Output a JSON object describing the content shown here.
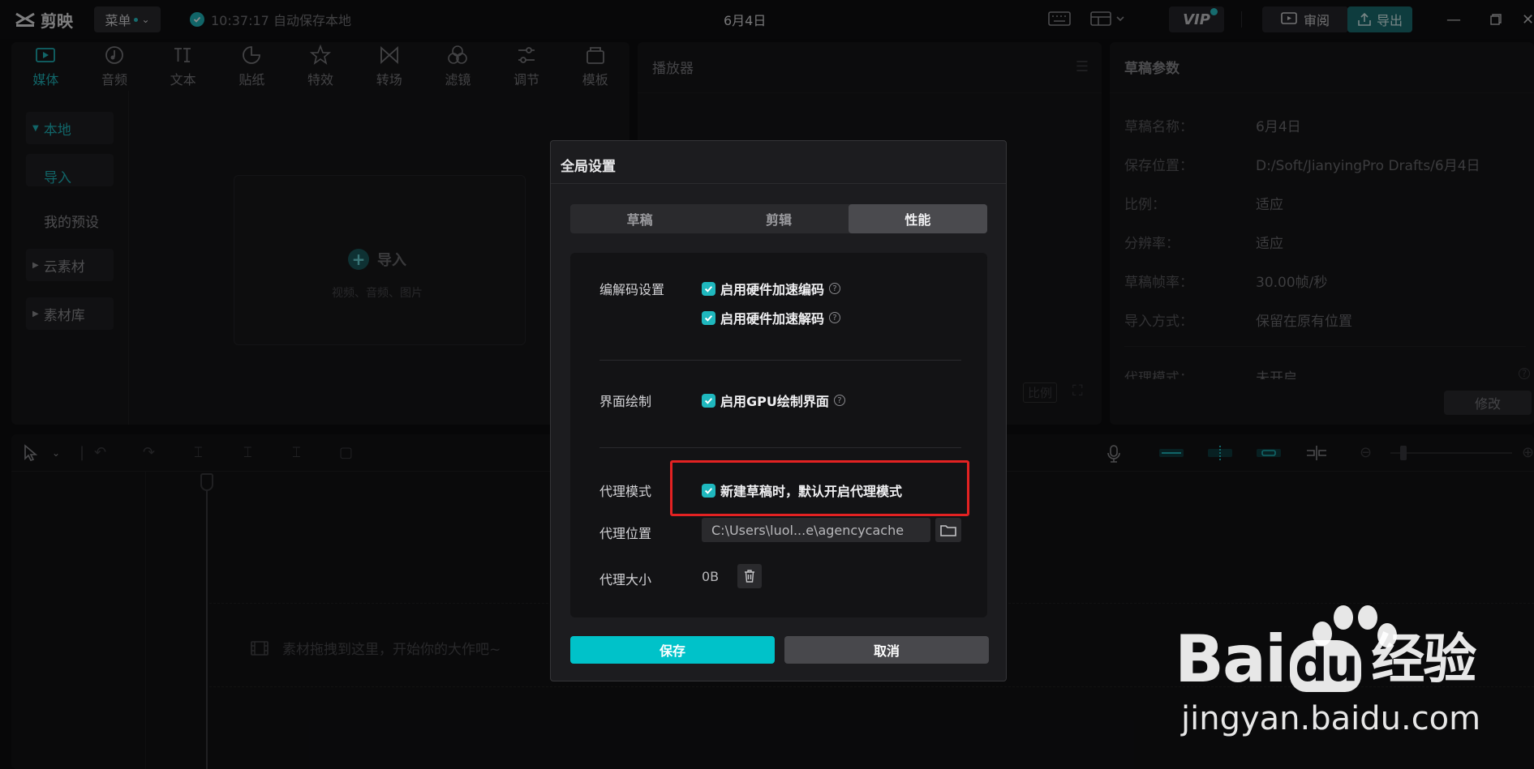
{
  "topbar": {
    "app_name": "剪映",
    "menu_label": "菜单",
    "autosave_text": "10:37:17 自动保存本地",
    "doc_title": "6月4日",
    "vip_label": "VIP",
    "review_label": "审阅",
    "export_label": "导出"
  },
  "media": {
    "tabs": [
      {
        "label": "媒体",
        "icon": "media-icon"
      },
      {
        "label": "音频",
        "icon": "audio-icon"
      },
      {
        "label": "文本",
        "icon": "text-icon"
      },
      {
        "label": "贴纸",
        "icon": "sticker-icon"
      },
      {
        "label": "特效",
        "icon": "effects-icon"
      },
      {
        "label": "转场",
        "icon": "transition-icon"
      },
      {
        "label": "滤镜",
        "icon": "filter-icon"
      },
      {
        "label": "调节",
        "icon": "adjust-icon"
      },
      {
        "label": "模板",
        "icon": "template-icon"
      }
    ],
    "nav": {
      "local": "本地",
      "import": "导入",
      "my_presets": "我的预设",
      "cloud": "云素材",
      "library": "素材库"
    },
    "import_box": {
      "title": "导入",
      "subtitle": "视频、音频、图片"
    }
  },
  "player": {
    "title": "播放器",
    "ratio_label": "比例"
  },
  "props": {
    "title": "草稿参数",
    "rows": [
      {
        "key": "草稿名称：",
        "value": "6月4日"
      },
      {
        "key": "保存位置：",
        "value": "D:/Soft/JianyingPro Drafts/6月4日"
      },
      {
        "key": "比例：",
        "value": "适应"
      },
      {
        "key": "分辨率：",
        "value": "适应"
      },
      {
        "key": "草稿帧率：",
        "value": "30.00帧/秒"
      },
      {
        "key": "导入方式：",
        "value": "保留在原有位置"
      },
      {
        "key": "代理模式：",
        "value": "未开启"
      }
    ],
    "modify_label": "修改"
  },
  "timeline": {
    "drop_hint": "素材拖拽到这里，开始你的大作吧~"
  },
  "dialog": {
    "title": "全局设置",
    "tabs": [
      "草稿",
      "剪辑",
      "性能"
    ],
    "active_tab": "性能",
    "codec_label": "编解码设置",
    "hw_encode": "启用硬件加速编码",
    "hw_decode": "启用硬件加速解码",
    "render_label": "界面绘制",
    "gpu_render": "启用GPU绘制界面",
    "proxy_mode_label": "代理模式",
    "proxy_default": "新建草稿时，默认开启代理模式",
    "proxy_path_label": "代理位置",
    "proxy_path_value": "C:\\Users\\luol...e\\agencycache",
    "proxy_size_label": "代理大小",
    "proxy_size_value": "0B",
    "save_label": "保存",
    "cancel_label": "取消"
  },
  "watermark": {
    "brand": "Bai",
    "brand_du": "du",
    "brand_cn": "经验",
    "url": "jingyan.baidu.com"
  },
  "colors": {
    "accent": "#1fb8be",
    "save_button": "#00c2c9",
    "highlight_border": "#e32222"
  }
}
